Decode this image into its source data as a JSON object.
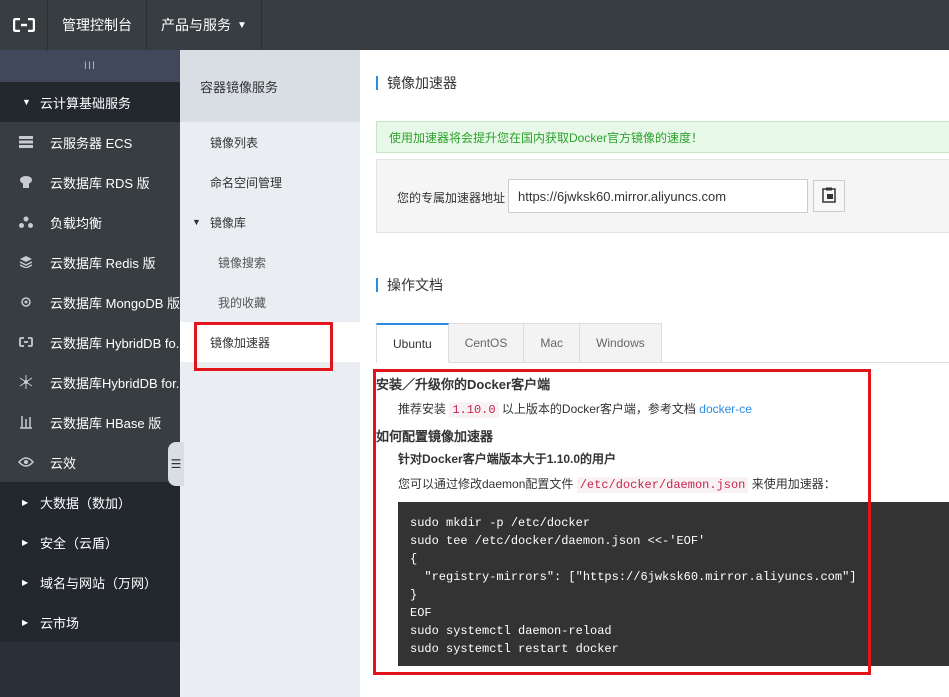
{
  "topbar": {
    "logo_icon": "aliyun-logo-icon",
    "console_label": "管理控制台",
    "products_label": "产品与服务",
    "products_caret_icon": "caret-down-icon"
  },
  "sidebar": {
    "collapse_glyph": "III",
    "group_title": "云计算基础服务",
    "items": [
      {
        "label": "云服务器 ECS",
        "icon": "server-icon"
      },
      {
        "label": "云数据库 RDS 版",
        "icon": "database-icon"
      },
      {
        "label": "负载均衡",
        "icon": "load-balancer-icon"
      },
      {
        "label": "云数据库 Redis 版",
        "icon": "redis-icon"
      },
      {
        "label": "云数据库 MongoDB 版",
        "icon": "mongodb-icon"
      },
      {
        "label": "云数据库 HybridDB fo...",
        "icon": "hybriddb-icon"
      },
      {
        "label": "云数据库HybridDB for...",
        "icon": "hybriddb-network-icon"
      },
      {
        "label": "云数据库 HBase 版",
        "icon": "hbase-icon"
      },
      {
        "label": "云效",
        "icon": "eye-icon"
      }
    ],
    "groups": [
      {
        "label": "大数据（数加）"
      },
      {
        "label": "安全（云盾）"
      },
      {
        "label": "域名与网站（万网）"
      },
      {
        "label": "云市场"
      }
    ]
  },
  "subnav": {
    "title": "容器镜像服务",
    "items": [
      {
        "label": "镜像列表"
      },
      {
        "label": "命名空间管理"
      }
    ],
    "group_label": "镜像库",
    "group_children": [
      {
        "label": "镜像搜索"
      },
      {
        "label": "我的收藏"
      }
    ],
    "active_label": "镜像加速器"
  },
  "main": {
    "title": "镜像加速器",
    "notice": "使用加速器将会提升您在国内获取Docker官方镜像的速度！",
    "mirror_label": "您的专属加速器地址",
    "mirror_url": "https://6jwksk60.mirror.aliyuncs.com",
    "copy_icon": "clipboard-icon",
    "doc_title": "操作文档",
    "tabs": [
      "Ubuntu",
      "CentOS",
      "Mac",
      "Windows"
    ],
    "active_tab": "Ubuntu",
    "doc": {
      "h_install": "安装／升级你的Docker客户端",
      "install_prefix": "推荐安装",
      "install_version": "1.10.0",
      "install_suffix": "以上版本的Docker客户端，参考文档",
      "install_link": "docker-ce",
      "h_config": "如何配置镜像加速器",
      "h_version": "针对Docker客户端版本大于1.10.0的用户",
      "config_prefix": "您可以通过修改daemon配置文件",
      "config_path": "/etc/docker/daemon.json",
      "config_suffix": "来使用加速器：",
      "code": "sudo mkdir -p /etc/docker\nsudo tee /etc/docker/daemon.json <<-'EOF'\n{\n  \"registry-mirrors\": [\"https://6jwksk60.mirror.aliyuncs.com\"]\n}\nEOF\nsudo systemctl daemon-reload\nsudo systemctl restart docker"
    }
  },
  "colors": {
    "accent": "#2b8be2",
    "highlight_box": "#e2161a",
    "topbar": "#373d41",
    "notice_text": "#2aa32a"
  }
}
